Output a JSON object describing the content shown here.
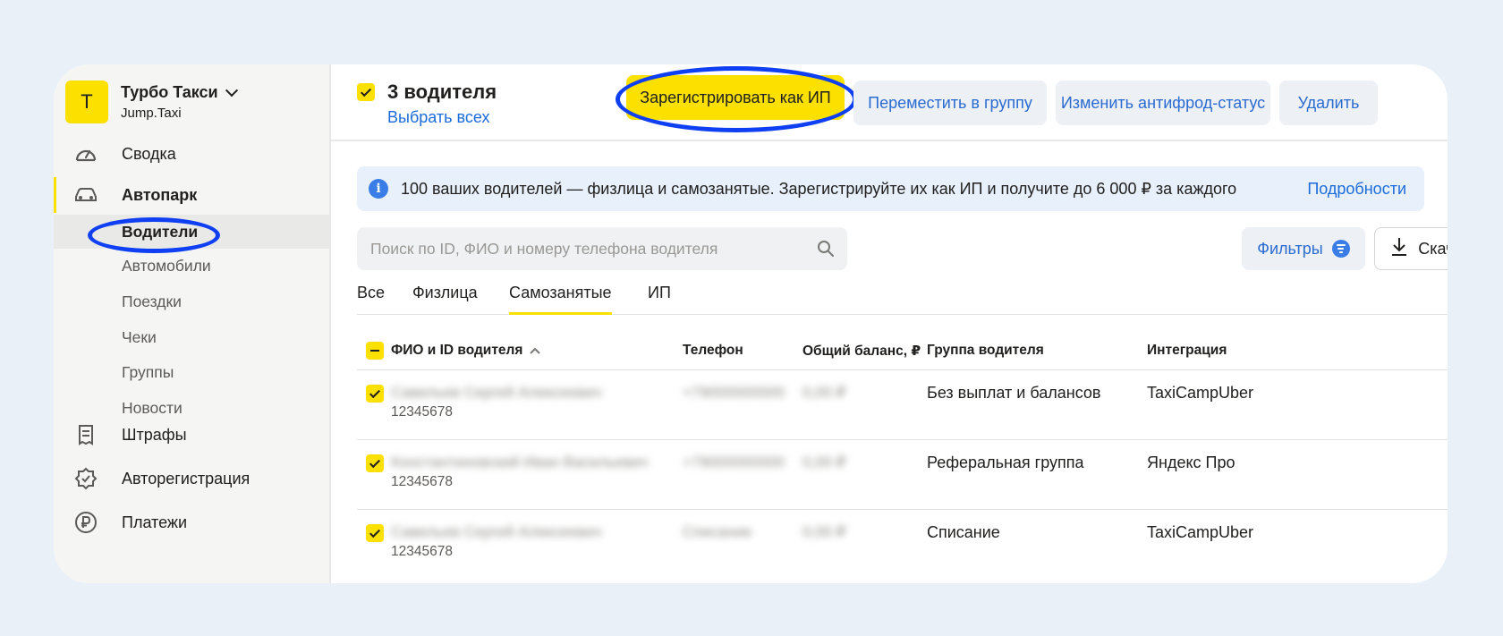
{
  "park": {
    "logo_letter": "Т",
    "name": "Турбо Такси",
    "subtitle": "Jump.Taxi"
  },
  "nav": {
    "summary": "Сводка",
    "fleet": "Автопарк",
    "fleet_sub": [
      "Водители",
      "Автомобили",
      "Поездки",
      "Чеки",
      "Группы",
      "Новости"
    ],
    "fines": "Штрафы",
    "autoreg": "Авторегистрация",
    "payments": "Платежи"
  },
  "toolbar": {
    "selected_count": "3 водителя",
    "select_all": "Выбрать всех",
    "register_ip": "Зарегистрировать как ИП",
    "move_group": "Переместить в группу",
    "antifraud": "Изменить антифрод-статус",
    "delete": "Удалить"
  },
  "banner": {
    "text": "100 ваших водителей — физлица и самозанятые. Зарегистрируйте их как ИП и получите до 6 000 ₽ за каждого",
    "link": "Подробности"
  },
  "search": {
    "placeholder": "Поиск по ID, ФИО и номеру телефона водителя"
  },
  "filters_label": "Фильтры",
  "download_label": "Скачать",
  "tabs": [
    "Все",
    "Физлица",
    "Самозанятые",
    "ИП"
  ],
  "active_tab": "Самозанятые",
  "table": {
    "headers": [
      "ФИО и ID водителя",
      "Телефон",
      "Общий баланс, ₽",
      "Группа водителя",
      "Интеграция"
    ],
    "rows": [
      {
        "name": "Савельев Сергей Алексеевич",
        "id": "12345678",
        "phone": "+79000000000",
        "balance": "0,00 ₽",
        "group": "Без выплат и балансов",
        "integration": "TaxiCampUber"
      },
      {
        "name": "Константиновский Иван Васильевич",
        "id": "12345678",
        "phone": "+79000000000",
        "balance": "0,00 ₽",
        "group": "Реферальная группа",
        "integration": "Яндекс Про"
      },
      {
        "name": "Савельев Сергей Алексеевич",
        "id": "12345678",
        "phone": "Списание",
        "balance": "0,00 ₽",
        "group": "Списание",
        "integration": "TaxiCampUber"
      }
    ]
  },
  "colors": {
    "accent": "#fce000",
    "link": "#1b6bd8",
    "highlight": "#0f3ff2",
    "background": "#eaf0f8"
  }
}
